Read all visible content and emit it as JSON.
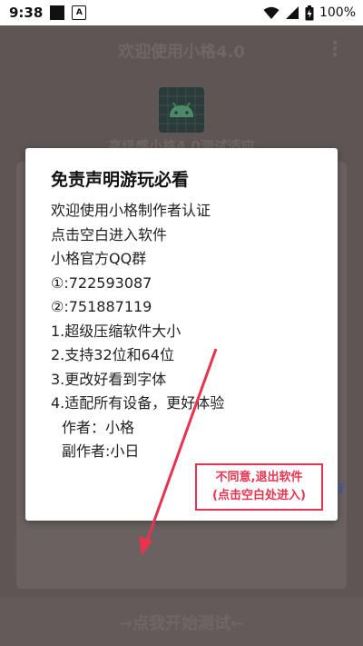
{
  "statusbar": {
    "time": "9:38",
    "notif_a_label": "A",
    "battery_pct": "100%",
    "icons": [
      "wifi-icon",
      "signal-icon",
      "battery-icon"
    ]
  },
  "background_app": {
    "title": "欢迎使用小格4.0",
    "subtitle": "高级感小格4.0测试适应",
    "side_text": "群",
    "bottom_button": "→点我开始测试←"
  },
  "dialog": {
    "title": "免责声明游玩必看",
    "lines": [
      "欢迎使用小格制作者认证",
      "点击空白进入软件",
      "小格官方QQ群",
      "①:722593087",
      "②:751887119",
      "1.超级压缩软件大小",
      "2.支持32位和64位",
      "3.更改好看到字体",
      "4.适配所有设备，更好体验",
      "作者：小格",
      "副作者:小日"
    ],
    "decline": {
      "line1": "不同意,退出软件",
      "line2": "(点击空白处进入)"
    }
  },
  "colors": {
    "overlay": "#5e5655",
    "accent_red": "#e8334f",
    "link_blue": "#3f55a8"
  }
}
